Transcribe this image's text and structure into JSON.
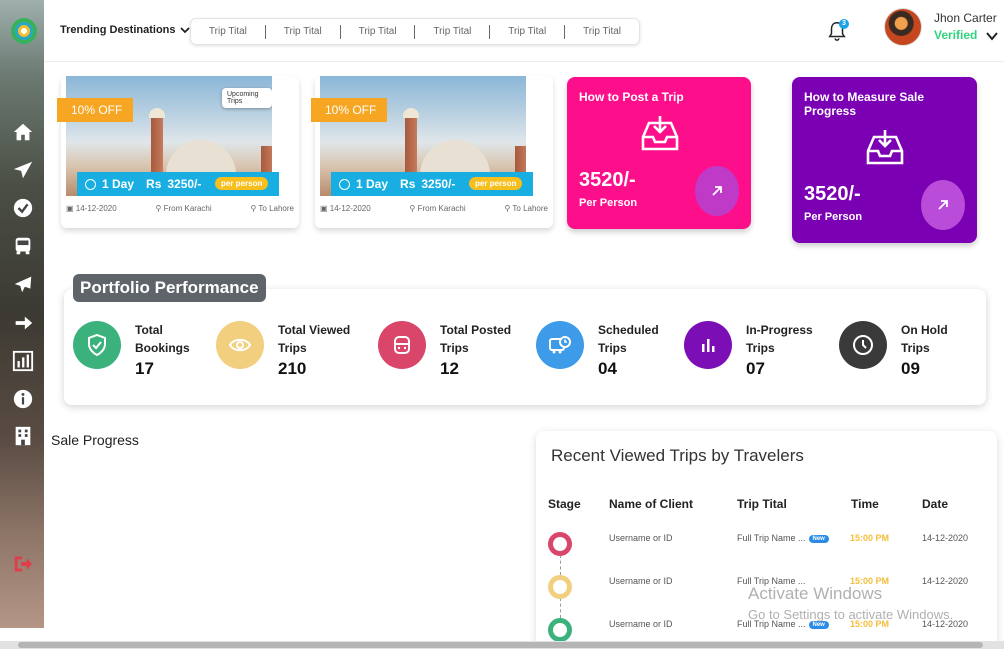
{
  "topbar": {
    "trending_label": "Trending Destinations",
    "trip_tabs": [
      "Trip Tital",
      "Trip Tital",
      "Trip Tital",
      "Trip Tital",
      "Trip Tital",
      "Trip Tital"
    ],
    "notification_count": "3",
    "user_name": "Jhon Carter",
    "user_status": "Verified"
  },
  "trips": [
    {
      "discount": "10% OFF",
      "badge": "Upcoming Trips",
      "duration": "1 Day",
      "price_prefix": "Rs",
      "price": "3250/-",
      "per_person": "per person",
      "date": "14-12-2020",
      "from": "From Karachi",
      "to": "To Lahore"
    },
    {
      "discount": "10% OFF",
      "badge": "",
      "duration": "1 Day",
      "price_prefix": "Rs",
      "price": "3250/-",
      "per_person": "per person",
      "date": "14-12-2020",
      "from": "From Karachi",
      "to": "To Lahore"
    }
  ],
  "promos": [
    {
      "title": "How to Post a Trip",
      "value": "3520/-",
      "unit": "Per Person",
      "color": "#fd0f8c"
    },
    {
      "title": "How to Measure Sale Progress",
      "value": "3520/-",
      "unit": "Per Person",
      "color": "#7b00b4"
    }
  ],
  "portfolio": {
    "title": "Portfolio Performance",
    "stats": [
      {
        "label": "Total Bookings",
        "value": "17",
        "color": "#3bb27c",
        "icon": "shield-check-icon"
      },
      {
        "label": "Total Viewed Trips",
        "value": "210",
        "color": "#f1cf7e",
        "icon": "eye-icon"
      },
      {
        "label": "Total Posted Trips",
        "value": "12",
        "color": "#d9466a",
        "icon": "bus-icon"
      },
      {
        "label": "Scheduled Trips",
        "value": "04",
        "color": "#3d9be9",
        "icon": "schedule-bus-icon"
      },
      {
        "label": "In-Progress Trips",
        "value": "07",
        "color": "#7b0fb5",
        "icon": "bar-chart-icon"
      },
      {
        "label": "On Hold Trips",
        "value": "09",
        "color": "#3a3a3a",
        "icon": "clock-icon"
      }
    ]
  },
  "sale_progress": {
    "title": "Sale Progress"
  },
  "recent": {
    "title": "Recent Viewed Trips by Travelers",
    "columns": [
      "Stage",
      "Name of Client",
      "Trip Tital",
      "Time",
      "Date"
    ],
    "rows": [
      {
        "stage_color": "#d9466a",
        "client": "Username or ID",
        "trip": "Full Trip Name ...",
        "badge": "New",
        "time": "15:00 PM",
        "date": "14-12-2020"
      },
      {
        "stage_color": "#f1cf7e",
        "client": "Username or ID",
        "trip": "Full Trip Name ...",
        "badge": "",
        "time": "15:00 PM",
        "date": "14-12-2020"
      },
      {
        "stage_color": "#3bb27c",
        "client": "Username or ID",
        "trip": "Full Trip Name ...",
        "badge": "New",
        "time": "15:00 PM",
        "date": "14-12-2020"
      }
    ]
  },
  "watermark": {
    "line1": "Activate Windows",
    "line2": "Go to Settings to activate Windows."
  },
  "sidebar": {
    "items": [
      "home-icon",
      "send-icon",
      "check-circle-icon",
      "bus-icon",
      "plane-icon",
      "arrow-right-icon",
      "bar-chart-icon",
      "info-icon",
      "building-icon",
      "logout-icon"
    ]
  }
}
